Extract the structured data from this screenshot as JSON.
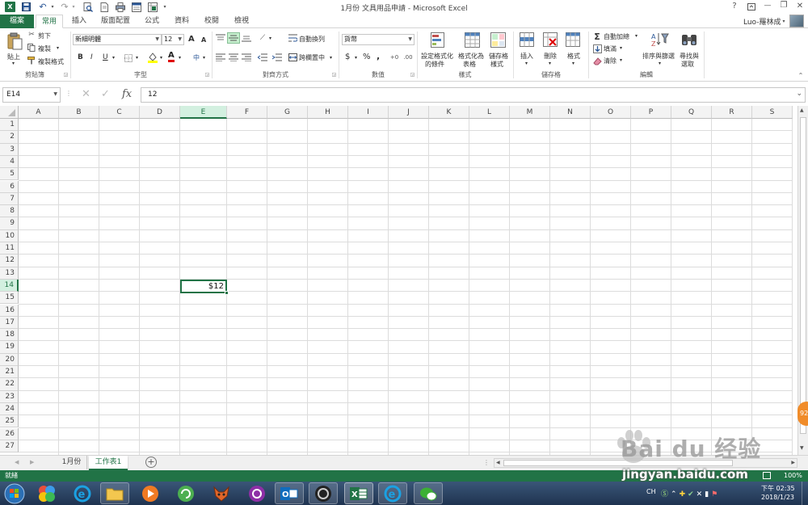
{
  "window": {
    "title": "1月份 文具用品申請 - Microsoft Excel",
    "help_glyph": "?",
    "min_glyph": "—",
    "restore_glyph": "❐",
    "close_glyph": "✕",
    "user_name": "Luo-羅林成"
  },
  "ribbon_tabs": [
    "檔案",
    "常用",
    "插入",
    "版面配置",
    "公式",
    "資料",
    "校閱",
    "檢視"
  ],
  "clipboard": {
    "paste": "貼上",
    "cut": "剪下",
    "copy": "複製",
    "format_painter": "複製格式",
    "group": "剪貼簿"
  },
  "font": {
    "name": "新細明體",
    "size": "12",
    "grow": "A",
    "shrink": "A",
    "bold": "B",
    "italic": "I",
    "underline": "U",
    "color_glyph": "A",
    "group": "字型"
  },
  "alignment": {
    "wrap": "自動換列",
    "merge": "跨欄置中",
    "group": "對齊方式"
  },
  "number": {
    "format": "貨幣",
    "currency": "$",
    "percent": "%",
    "comma": ",",
    "group": "數值"
  },
  "styles": {
    "cond_line1": "設定格式化",
    "cond_line2": "的條件",
    "table_line1": "格式化為",
    "table_line2": "表格",
    "cell_line1": "儲存格",
    "cell_line2": "樣式",
    "group": "樣式"
  },
  "cells": {
    "insert": "插入",
    "delete": "刪除",
    "format": "格式",
    "group": "儲存格"
  },
  "editing": {
    "autosum": "自動加總",
    "fill": "填滿",
    "clear": "清除",
    "sort_line1": "排序與篩選",
    "find_line1": "尋找與",
    "find_line2": "選取",
    "group": "編輯"
  },
  "formula_bar": {
    "name_box": "E14",
    "fx": "fx",
    "cancel_glyph": "✕",
    "enter_glyph": "✓",
    "formula": "12"
  },
  "sheet": {
    "columns": [
      "A",
      "B",
      "C",
      "D",
      "E",
      "F",
      "G",
      "H",
      "I",
      "J",
      "K",
      "L",
      "M",
      "N",
      "O",
      "P",
      "Q",
      "R",
      "S"
    ],
    "rows": [
      "1",
      "2",
      "3",
      "4",
      "5",
      "6",
      "7",
      "8",
      "9",
      "10",
      "11",
      "12",
      "13",
      "14",
      "15",
      "16",
      "17",
      "18",
      "19",
      "20",
      "21",
      "22",
      "23",
      "24",
      "25",
      "26",
      "27"
    ],
    "active_cell_value": "$12",
    "tabs": [
      "1月份",
      "工作表1"
    ],
    "active_tab": "工作表1",
    "add_sheet": "+"
  },
  "status": {
    "ready": "就緒",
    "zoom": "100%",
    "float_badge": "92"
  },
  "tray": {
    "lang": "CH",
    "time": "下午 02:35",
    "date": "2018/1/23"
  },
  "watermark": {
    "brand": "Bai du 经验",
    "url": "jingyan.baidu.com"
  },
  "colors": {
    "excel_green": "#217346",
    "selection_green": "#217346",
    "header_bg": "#f3f3f3"
  }
}
